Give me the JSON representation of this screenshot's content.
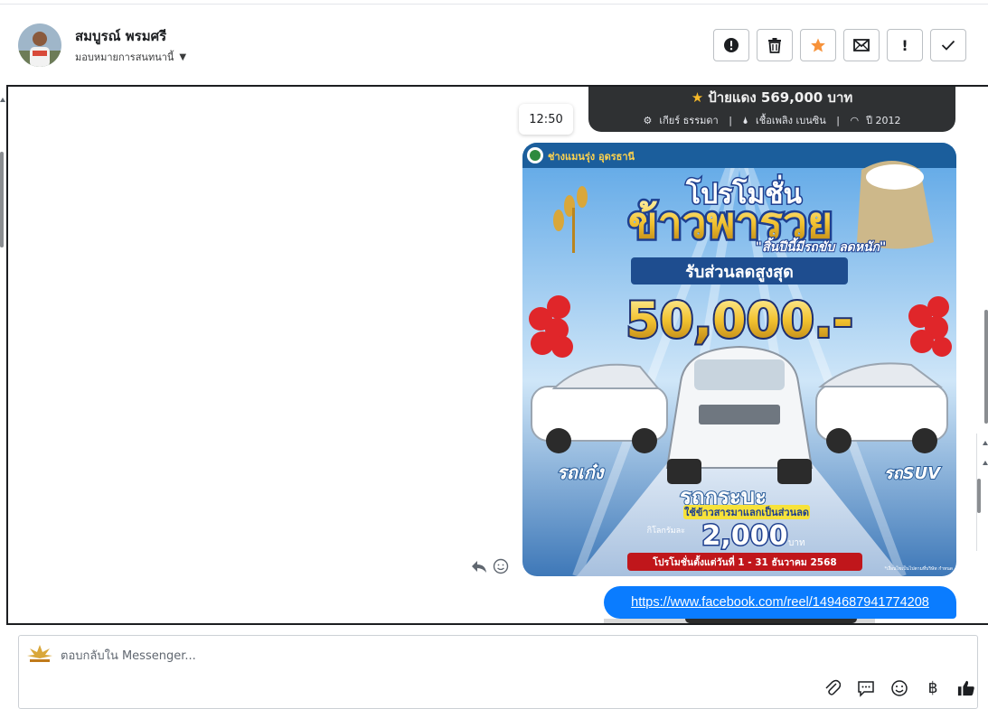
{
  "header": {
    "contact_name": "สมบูรณ์ พรมศรี",
    "assign_label": "มอบหมายการสนทนานี้",
    "actions": [
      {
        "name": "spam-button",
        "icon": "alert-circle-icon"
      },
      {
        "name": "delete-button",
        "icon": "trash-icon"
      },
      {
        "name": "star-button",
        "icon": "star-icon"
      },
      {
        "name": "mark-unread-button",
        "icon": "envelope-icon"
      },
      {
        "name": "follow-up-button",
        "icon": "exclamation-icon",
        "label": "!"
      },
      {
        "name": "mark-done-button",
        "icon": "checkmark-icon"
      }
    ]
  },
  "conversation": {
    "previous_card": {
      "price": "ป้ายแดง 569,000 บาท",
      "gear": "เกียร์ ธรรมดา",
      "fuel": "เชื้อเพลิง เบนซิน",
      "year": "ปี 2012",
      "separator": "|"
    },
    "timestamp": "12:50",
    "promo_image": {
      "dealer": "ช่างแมนรุ่ง อุดรธานี",
      "headline_1": "โปรโมชั่น",
      "headline_2": "ข้าวพารวย",
      "tagline": "\"สิ้นปีนี้มีรถขับ ลดหนัก\"",
      "discount_label": "รับส่วนลดสูงสุด",
      "discount_amount": "50,000.-",
      "left_tag": "รถเก๋ง",
      "right_tag": "รถSUV",
      "center_tag": "รถกระบะ",
      "rice_trade": "ใช้ข้าวสารมาแลกเป็นส่วนลด",
      "per_kg": "กิโลกรัมละ",
      "price_per_kg": "2,000",
      "baht": "บาท",
      "period": "โปรโมชั่นตั้งแต่วันที่ 1 - 31 ธันวาคม 2568",
      "fine_print": "*เงื่อนไขเป็นไปตามที่บริษัท กำหนด"
    },
    "link_text": "https://www.facebook.com/reel/1494687941774208"
  },
  "composer": {
    "placeholder": "ตอบกลับใน Messenger..."
  },
  "colors": {
    "accent": "#0a7cff",
    "star": "#f7b928",
    "card_dark": "#2f3133"
  }
}
